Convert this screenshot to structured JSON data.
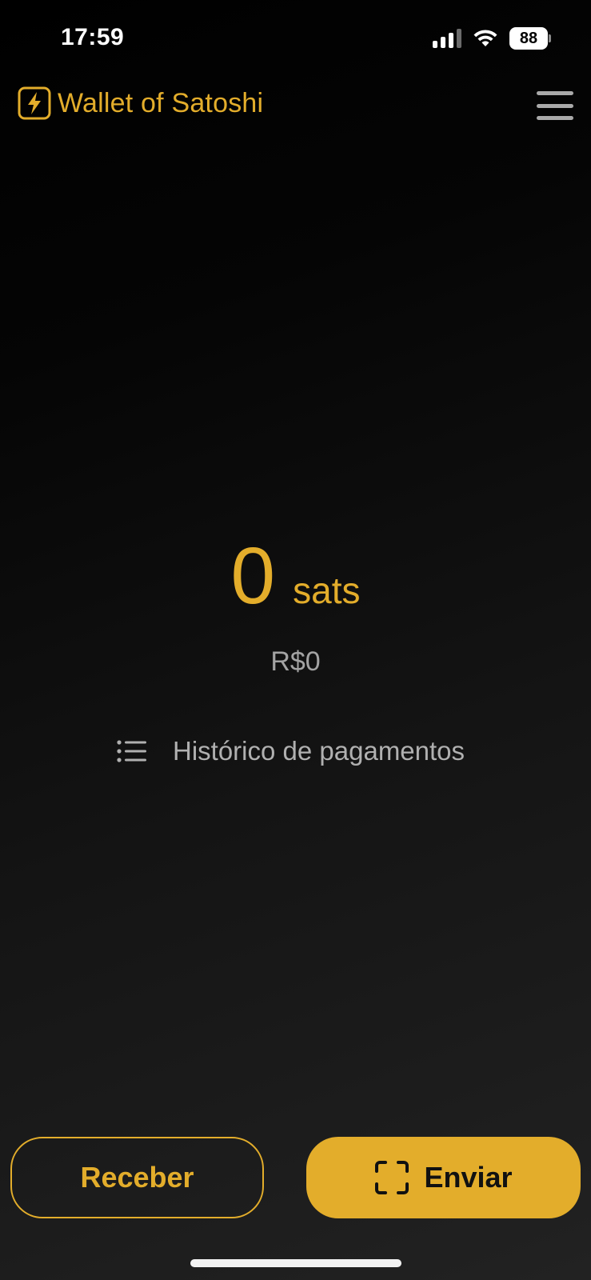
{
  "status_bar": {
    "time": "17:59",
    "battery": "88",
    "icons": [
      "cellular-signal-icon",
      "wifi-icon",
      "battery-icon"
    ]
  },
  "header": {
    "app_name": "Wallet of Satoshi",
    "logo_icon": "lightning-bolt-icon",
    "menu_icon": "hamburger-menu-icon"
  },
  "balance": {
    "amount": "0",
    "unit": "sats",
    "fiat": "R$0"
  },
  "history": {
    "label": "Histórico de pagamentos",
    "icon": "list-icon"
  },
  "actions": {
    "receive_label": "Receber",
    "send_label": "Enviar",
    "send_icon": "scan-qr-icon"
  },
  "colors": {
    "accent": "#e3ad2b",
    "background": "#000000",
    "muted_text": "#a3a3a3"
  }
}
